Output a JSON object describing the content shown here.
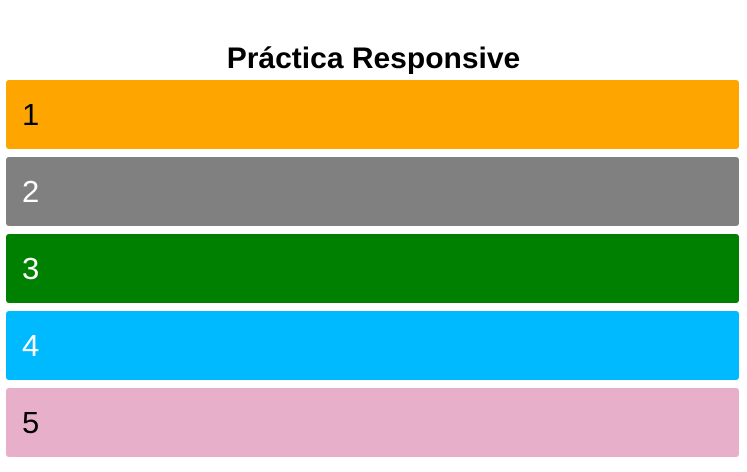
{
  "page": {
    "title": "Práctica Responsive"
  },
  "boxes": [
    {
      "label": "1",
      "background": "#FFA500",
      "text_color": "#000000"
    },
    {
      "label": "2",
      "background": "#808080",
      "text_color": "#FFFFFF"
    },
    {
      "label": "3",
      "background": "#008000",
      "text_color": "#FFFFFF"
    },
    {
      "label": "4",
      "background": "#00BAFF",
      "text_color": "#FFFFFF"
    },
    {
      "label": "5",
      "background": "#E8AFCB",
      "text_color": "#000000"
    }
  ]
}
